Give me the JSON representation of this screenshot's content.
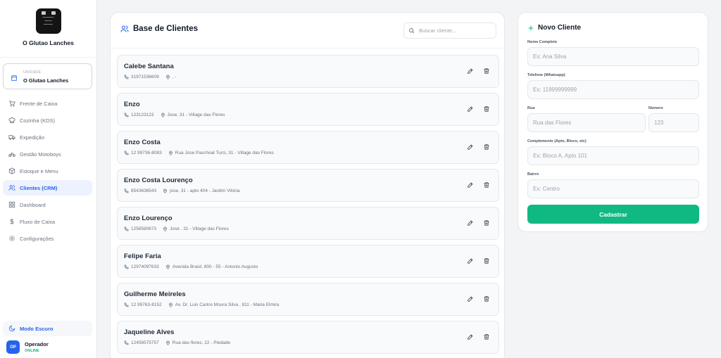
{
  "brand": {
    "name": "O Glutao Lanches"
  },
  "unit": {
    "label": "UNIDADE",
    "name": "O Glutao Lanches"
  },
  "nav": {
    "items": [
      {
        "label": "Frente de Caixa",
        "icon": "cart-icon"
      },
      {
        "label": "Cozinha (KDS)",
        "icon": "chef-hat-icon"
      },
      {
        "label": "Expedição",
        "icon": "truck-icon"
      },
      {
        "label": "Gestão Motoboys",
        "icon": "bike-icon"
      },
      {
        "label": "Estoque e Menu",
        "icon": "box-icon"
      },
      {
        "label": "Clientes (CRM)",
        "icon": "users-icon",
        "active": true
      },
      {
        "label": "Dashboard",
        "icon": "grid-icon"
      },
      {
        "label": "Fluxo de Caixa",
        "icon": "dollar-icon"
      },
      {
        "label": "Configurações",
        "icon": "gear-icon"
      }
    ]
  },
  "dark_mode": {
    "label": "Modo Escuro"
  },
  "operator": {
    "initials": "OP",
    "name": "Operador",
    "status": "ONLINE"
  },
  "clients": {
    "title": "Base de Clientes",
    "search_placeholder": "Buscar cliente...",
    "rows": [
      {
        "name": "Calebe Santana",
        "phone": "31971536609",
        "address": ", -"
      },
      {
        "name": "Enzo",
        "phone": "123123123",
        "address": "Jose, 31 - Village das Flores"
      },
      {
        "name": "Enzo Costa",
        "phone": "12 99736-8083",
        "address": "Rua Jose Paschoal Turci, 31 - Village das Flores"
      },
      {
        "name": "Enzo Costa Lourenço",
        "phone": "8543636543",
        "address": "jose, 31 - apto 404 - Jardim Vitória"
      },
      {
        "name": "Enzo Lourenço",
        "phone": "1258580673",
        "address": "José , 31 - Village das Flores"
      },
      {
        "name": "Felipe Faria",
        "phone": "12974097633",
        "address": "Avenida Brasil, 800 - 55 - Antonio Augusto"
      },
      {
        "name": "Guilherme Meireles",
        "phone": "12 99763-8152",
        "address": "Av. Dr. Luis Carlos Moura Silva , 811 - Maria Elmira"
      },
      {
        "name": "Jaqueline Alves",
        "phone": "12456575757",
        "address": "Rua das flores, 22 - Piedade"
      }
    ]
  },
  "form": {
    "title": "Novo Cliente",
    "name_label": "Nome Completo",
    "name_placeholder": "Ex: Ana Silva",
    "phone_label": "Telefone (Whatsapp)",
    "phone_placeholder": "Ex: 11999999999",
    "street_label": "Rua",
    "street_placeholder": "Rua das Flores",
    "number_label": "Número",
    "number_placeholder": "123",
    "complement_label": "Complemento (Apto, Bloco, etc)",
    "complement_placeholder": "Ex: Bloco A, Apto 101",
    "district_label": "Bairro",
    "district_placeholder": "Ex: Centro",
    "submit_label": "Cadastrar"
  },
  "colors": {
    "accent": "#2563eb",
    "success": "#10b981",
    "background": "#f3f4f6"
  }
}
